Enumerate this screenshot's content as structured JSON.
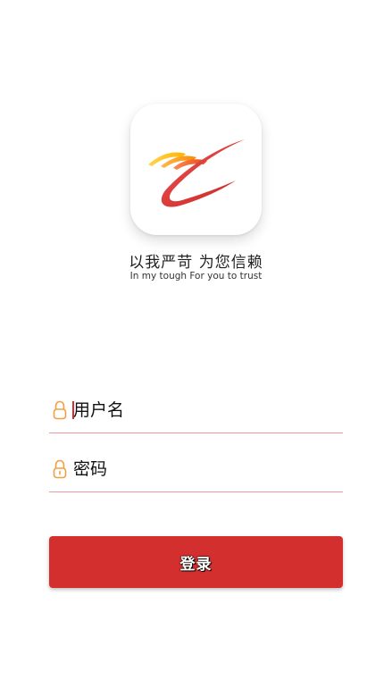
{
  "app": {
    "logo_icon": "brand-logo-icon",
    "slogan_cn": "以我严苛 为您信赖",
    "slogan_en": "In my tough For you to trust"
  },
  "form": {
    "username": {
      "placeholder": "用户名",
      "icon": "lock-icon"
    },
    "password": {
      "placeholder": "密码",
      "icon": "lock-icon"
    },
    "login_label": "登录"
  },
  "colors": {
    "accent": "#d32f2f",
    "icon_orange": "#f0a040",
    "divider": "#ef9a9a"
  }
}
